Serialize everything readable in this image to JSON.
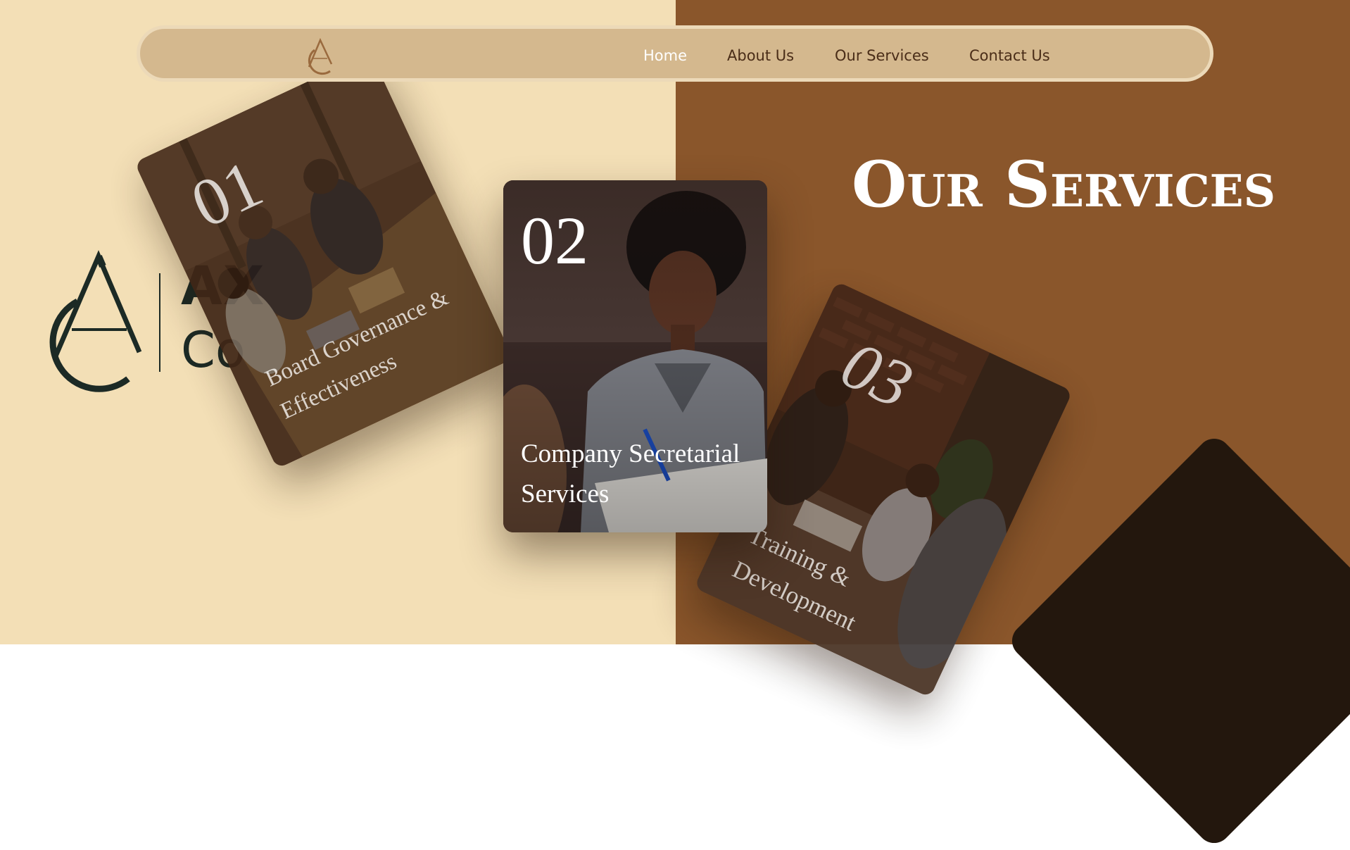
{
  "colors": {
    "left_background": "#f3dfb6",
    "right_background": "#8a562b",
    "navbar_background": "#d4b88e",
    "navbar_border": "#ecd9b8",
    "nav_text": "#4a2d18",
    "nav_active_text": "#ffffff",
    "brand_dark": "#1c2a25",
    "dark_shape": "#23170d"
  },
  "nav": {
    "logo_icon": "ac-monogram-icon",
    "links": [
      {
        "label": "Home",
        "active": true
      },
      {
        "label": "About Us",
        "active": false
      },
      {
        "label": "Our Services",
        "active": false
      },
      {
        "label": "Contact Us",
        "active": false
      }
    ]
  },
  "brand": {
    "logo_icon": "ac-monogram-icon",
    "name_visible": "AX",
    "sub_visible": "Co"
  },
  "heading": "Our Services",
  "cards": [
    {
      "number": "01",
      "title": "Board Governance & Effectiveness",
      "image": "boardroom-meeting-photo"
    },
    {
      "number": "02",
      "title": "Company Secretarial Services",
      "image": "businesswoman-signing-photo"
    },
    {
      "number": "03",
      "title": "Training & Development",
      "image": "training-session-photo"
    }
  ]
}
